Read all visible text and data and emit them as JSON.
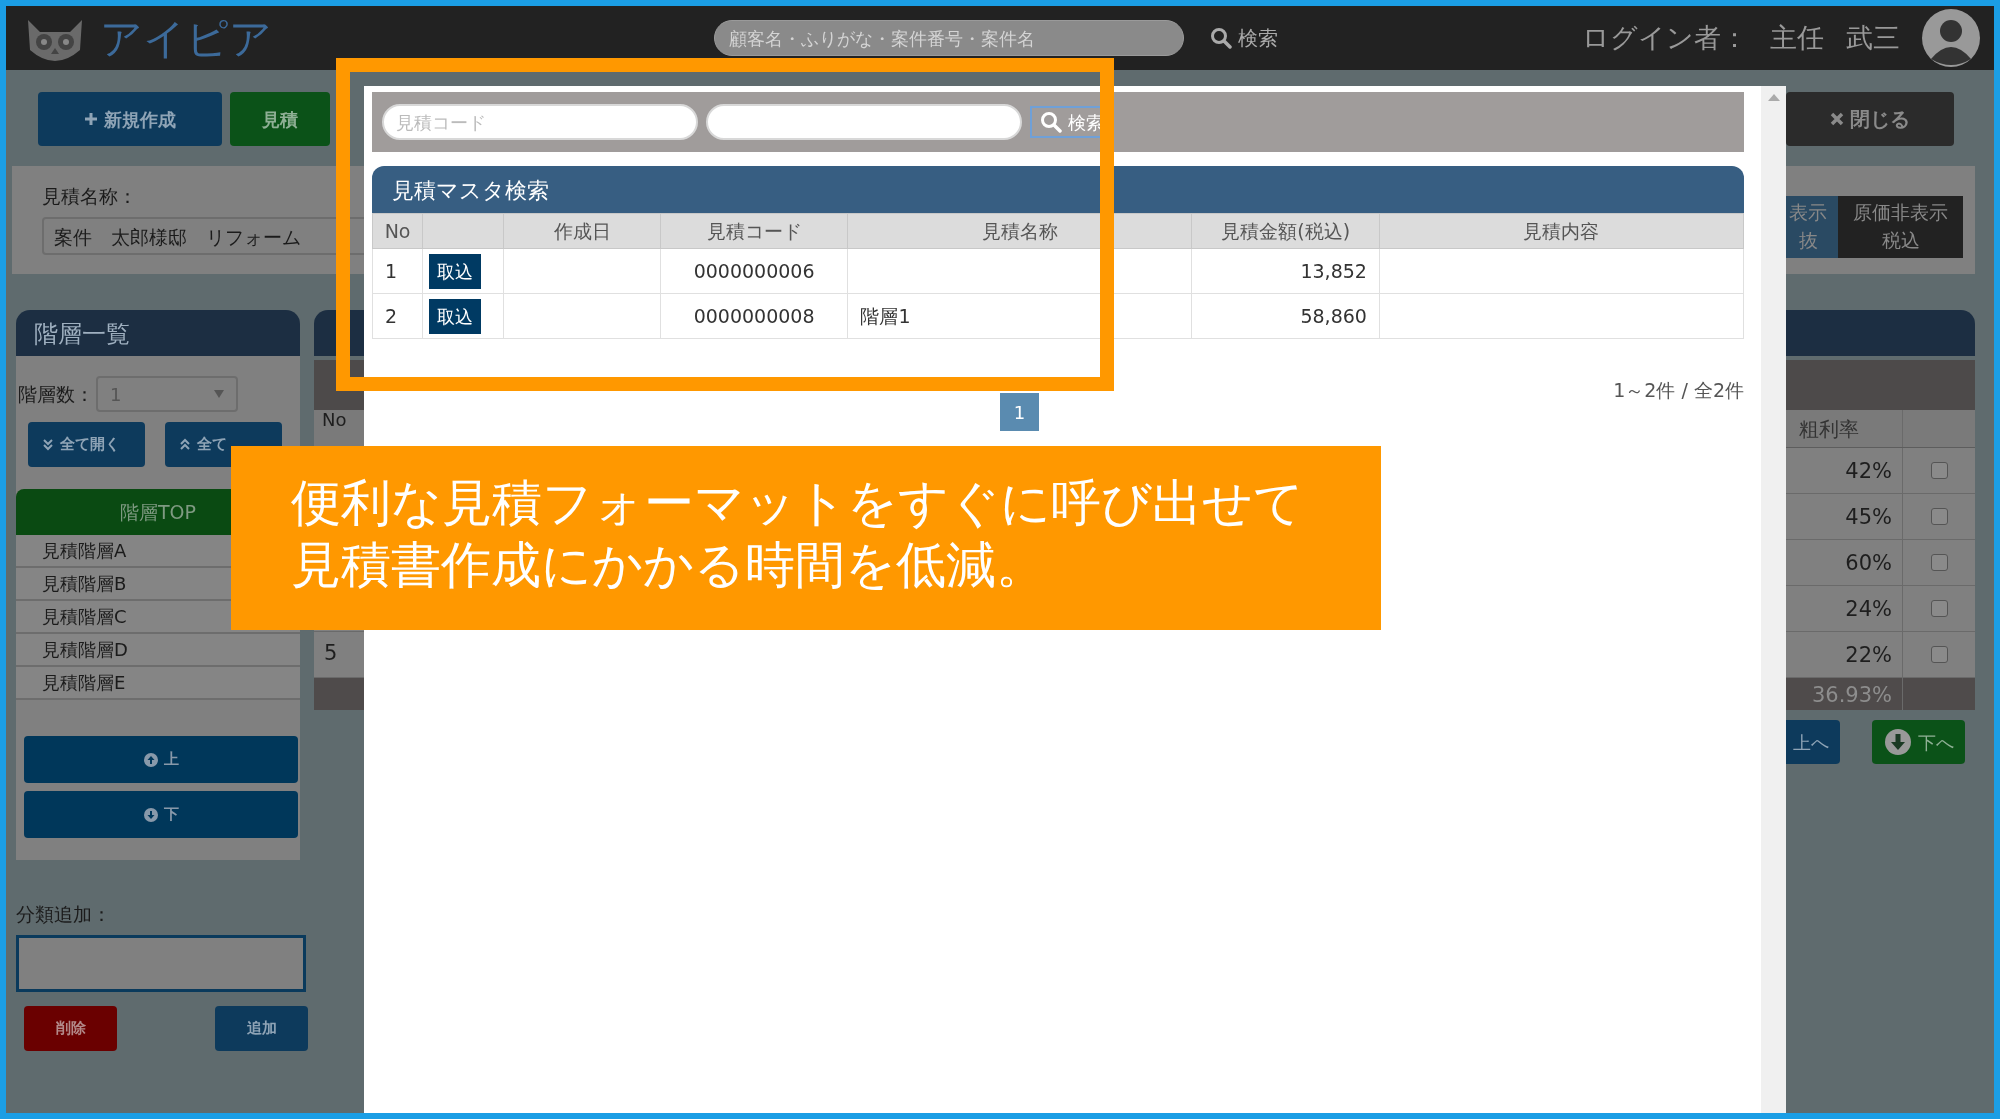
{
  "header": {
    "logo": "アイピア",
    "search": {
      "placeholder": "顧客名・ふりがな・案件番号・案件名"
    },
    "search_button": "検索",
    "login_label": "ログイン者：",
    "user_title": "主任",
    "user_name": "武三"
  },
  "toolbar": {
    "buttons": [
      {
        "label": "新規作成",
        "kind": "primary"
      },
      {
        "label": "見積",
        "kind": "success"
      }
    ],
    "close_button": "閉じる"
  },
  "estimate_name": {
    "label": "見積名称：",
    "value": "案件　太郎様邸　リフォーム"
  },
  "display_toggles": [
    {
      "lines": [
        "表示",
        "抜"
      ],
      "selected": true
    },
    {
      "lines": [
        "原価非表示",
        "税込"
      ],
      "selected": false
    }
  ],
  "hierarchy": {
    "title": "階層一覧",
    "count_label": "階層数：",
    "count_value": "1",
    "expand_buttons": [
      {
        "label": "全て開く",
        "kind": "down"
      },
      {
        "label": "全て",
        "kind": "up"
      }
    ],
    "top": "階層TOP",
    "items": [
      {
        "label": "見積階層A"
      },
      {
        "label": "見積階層B"
      },
      {
        "label": "見積階層C"
      },
      {
        "label": "見積階層D"
      },
      {
        "label": "見積階層E"
      }
    ],
    "move_buttons": [
      {
        "label": "上",
        "kind": "up"
      },
      {
        "label": "下",
        "kind": "down"
      }
    ]
  },
  "category": {
    "label": "分類追加：",
    "buttons": [
      {
        "label": "削除",
        "kind": "danger"
      },
      {
        "label": "追加",
        "kind": "primary"
      }
    ]
  },
  "detail_table": {
    "no_column": "No",
    "rate_column": "粗利率",
    "rows": [
      {
        "rate": "42%",
        "checked": false
      },
      {
        "rate": "45%",
        "checked": false
      },
      {
        "rate": "60%",
        "checked": false
      },
      {
        "rate": "24%",
        "checked": false
      },
      {
        "no": "5",
        "rate": "22%",
        "checked": false
      }
    ],
    "total_rate": "36.93%",
    "nav_buttons": [
      {
        "label": "上へ",
        "kind": "primary"
      },
      {
        "label": "下へ",
        "kind": "success"
      }
    ]
  },
  "modal": {
    "search": {
      "code_placeholder": "見積コード",
      "button": "検索"
    },
    "title": "見積マスタ検索",
    "columns": [
      {
        "label": "No",
        "kind": "no"
      },
      {
        "kind": "action"
      },
      {
        "label": "作成日",
        "kind": "date"
      },
      {
        "label": "見積コード",
        "kind": "code"
      },
      {
        "label": "見積名称",
        "kind": "name"
      },
      {
        "label": "見積金額(税込)",
        "kind": "amount"
      },
      {
        "label": "見積内容",
        "kind": "content"
      }
    ],
    "rows": [
      {
        "no": "1",
        "action": "取込",
        "code": "0000000006",
        "amount": "13,852"
      },
      {
        "no": "2",
        "action": "取込",
        "code": "0000000008",
        "name": "階層1",
        "amount": "58,860"
      }
    ],
    "pages": [
      {
        "label": "1",
        "selected": true
      }
    ],
    "count": "1～2件 / 全2件"
  },
  "callout": {
    "lines": [
      "便利な見積フォーマットをすぐに呼び出せて",
      "見積書作成にかかる時間を低減。"
    ]
  }
}
